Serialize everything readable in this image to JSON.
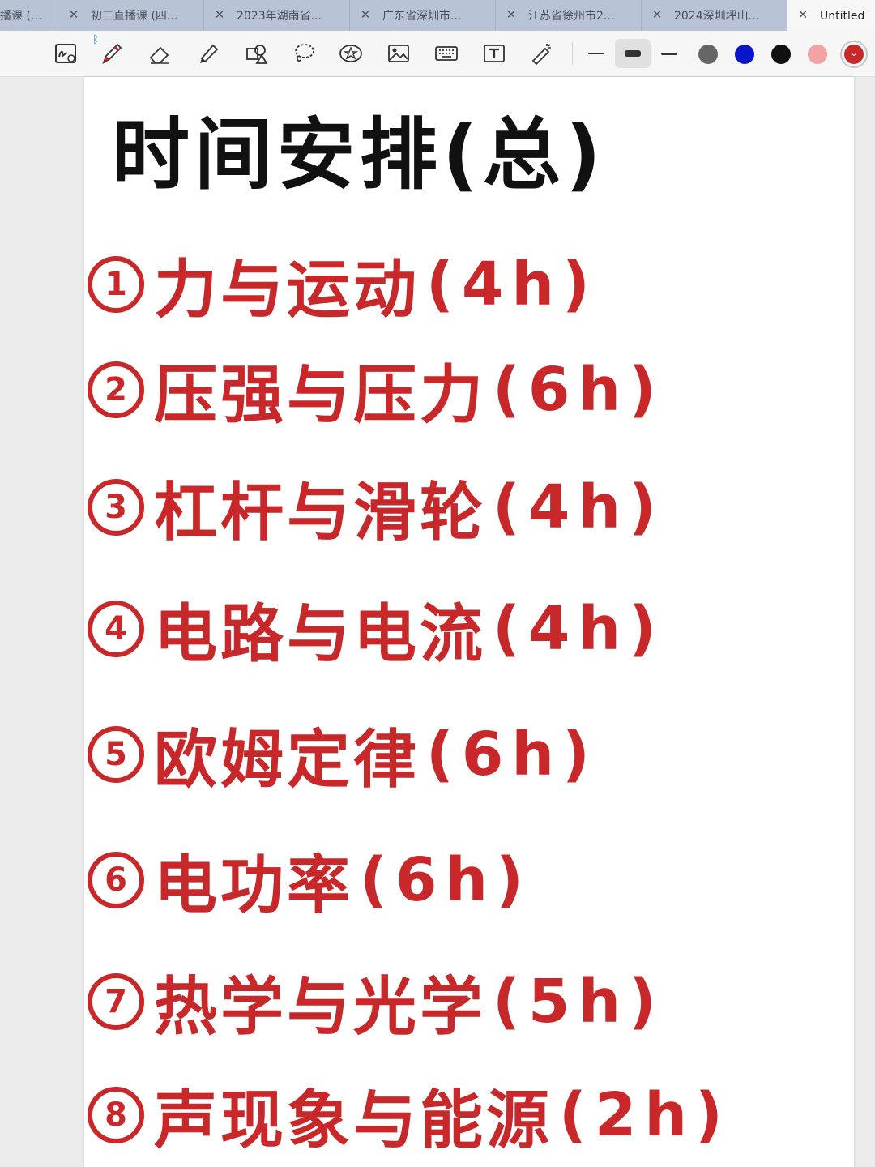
{
  "tabs": [
    {
      "label": "播课 (三...",
      "active": false
    },
    {
      "label": "初三直播课 (四...",
      "active": false
    },
    {
      "label": "2023年湖南省...",
      "active": false
    },
    {
      "label": "广东省深圳市...",
      "active": false
    },
    {
      "label": "江苏省徐州市2...",
      "active": false
    },
    {
      "label": "2024深圳坪山...",
      "active": false
    },
    {
      "label": "Untitled",
      "active": true
    }
  ],
  "toolbar": {
    "tools": [
      "zoom-in-pen-icon",
      "pen-icon",
      "eraser-icon",
      "highlighter-icon",
      "shapes-icon",
      "lasso-icon",
      "sticker-icon",
      "image-icon",
      "keyboard-icon",
      "text-box-icon",
      "laser-pointer-icon"
    ],
    "bluetooth_indicator": "ᛒ",
    "strokes": [
      "thin",
      "medium",
      "thick"
    ],
    "selected_stroke": "medium",
    "colors": [
      "#666666",
      "#0a14c8",
      "#111111",
      "#f2a3a3",
      "#c9282a"
    ],
    "selected_color": "#c9282a"
  },
  "note": {
    "title": "时间安排(总)",
    "items": [
      {
        "num": "1",
        "topic": "力与运动",
        "hours": "(4h)"
      },
      {
        "num": "2",
        "topic": "压强与压力",
        "hours": "(6h)"
      },
      {
        "num": "3",
        "topic": "杠杆与滑轮",
        "hours": "(4h)"
      },
      {
        "num": "4",
        "topic": "电路与电流",
        "hours": "(4h)"
      },
      {
        "num": "5",
        "topic": "欧姆定律",
        "hours": "(6h)"
      },
      {
        "num": "6",
        "topic": "电功率",
        "hours": "(6h)"
      },
      {
        "num": "7",
        "topic": "热学与光学",
        "hours": "(5h)"
      },
      {
        "num": "8",
        "topic": "声现象与能源",
        "hours": "(2h)"
      }
    ],
    "ink_color": "#c9282a",
    "title_color": "#111111"
  }
}
